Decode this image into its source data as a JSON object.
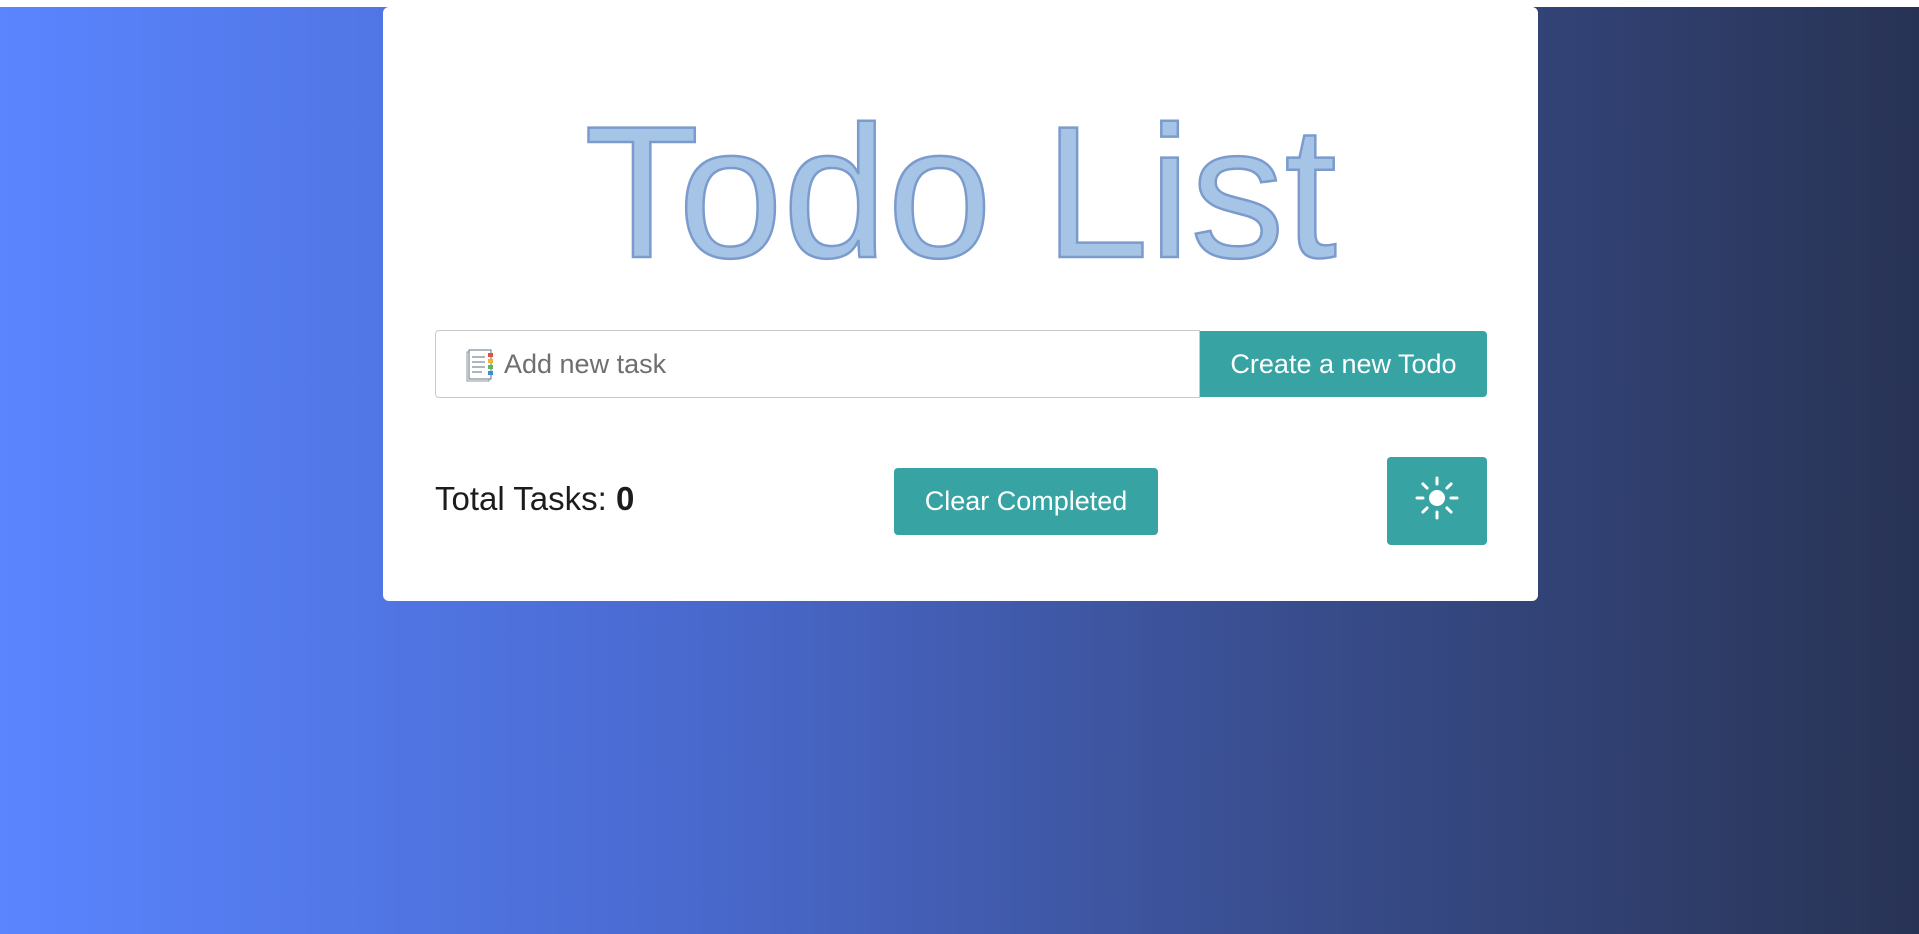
{
  "app": {
    "title": "Todo List"
  },
  "task_input": {
    "placeholder": "Add new task",
    "value": "",
    "icon": "notepad-icon"
  },
  "buttons": {
    "create_label": "Create a new Todo",
    "clear_label": "Clear Completed",
    "theme_icon": "sun-icon"
  },
  "stats": {
    "total_label": "Total Tasks:",
    "total_count": "0"
  },
  "colors": {
    "accent": "#37a3a2",
    "title_fill": "#a6c4e6",
    "title_stroke": "#7b9bcd",
    "background_start": "#5a85ff",
    "background_end": "#283354"
  }
}
